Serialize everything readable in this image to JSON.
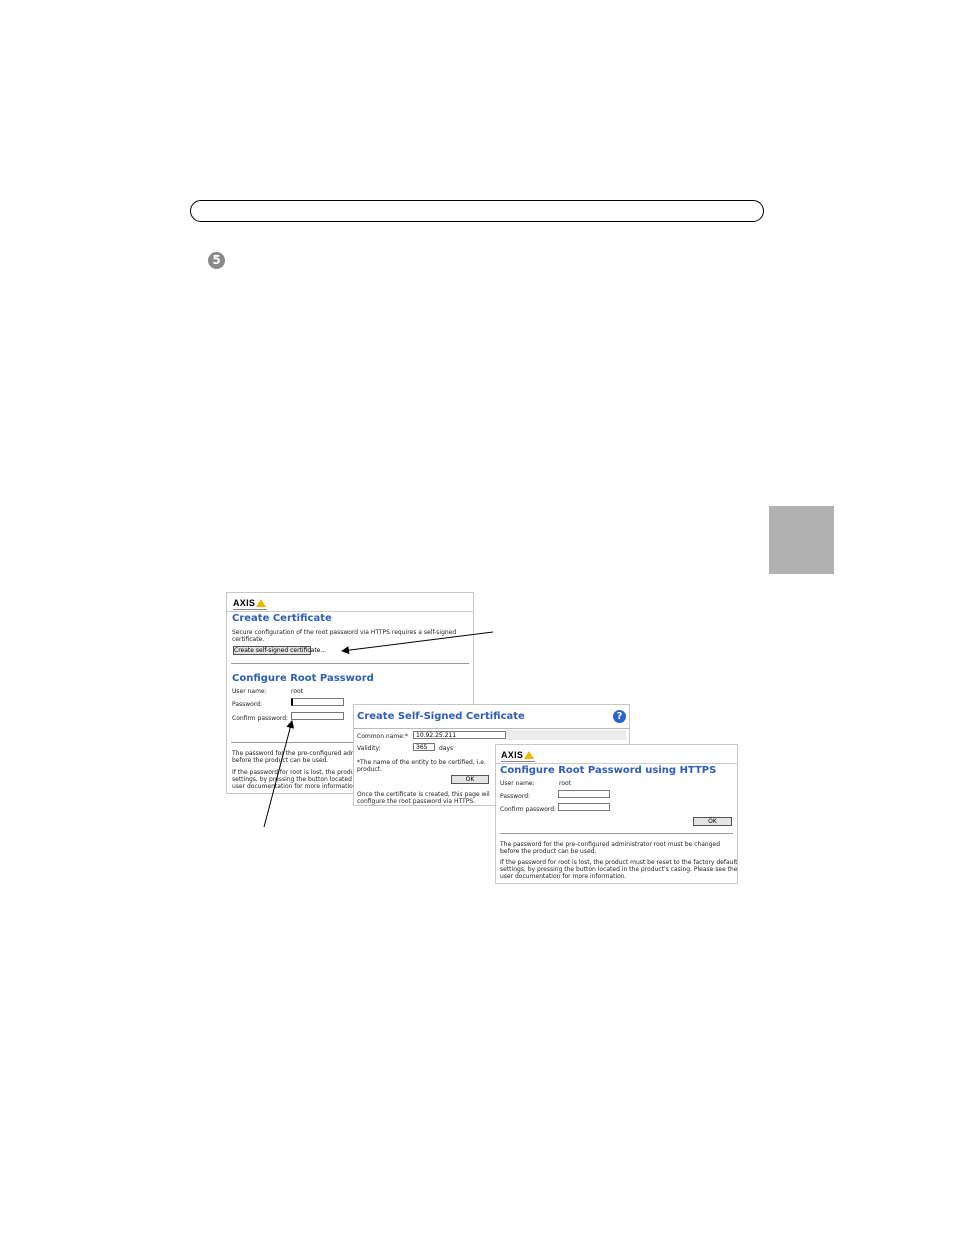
{
  "page": {
    "step_number": "5"
  },
  "panel_create_cert": {
    "logo": "AXIS",
    "title": "Create Certificate",
    "desc_line1": "Secure configuration of the root password via HTTPS requires a self-signed",
    "desc_line2": "certificate.",
    "button_label": "Create self-signed certificate...",
    "section_title": "Configure Root Password",
    "user_name_label": "User name:",
    "user_name_value": "root",
    "password_label": "Password:",
    "confirm_label": "Confirm password:",
    "note1_line1": "The password for the pre-configured admin",
    "note1_line2": "before the product can be used.",
    "note2_line1": "If the password for root is lost, the produ",
    "note2_line2": "settings, by pressing the button located i",
    "note2_line3": "user documentation for more information."
  },
  "panel_self_signed": {
    "title": "Create Self-Signed Certificate",
    "common_name_label": "Common name:*",
    "common_name_value": "10.92.25.211",
    "validity_label": "Validity:",
    "validity_value": "365",
    "validity_unit": "days",
    "note_line1": "*The name of the entity to be certified, i.e.",
    "note_line2": "product.",
    "ok_label": "OK",
    "after_line1": "Once the certificate is created, this page wil",
    "after_line2": "configure the root password via HTTPS.",
    "help_icon": "?"
  },
  "panel_https": {
    "logo": "AXIS",
    "title": "Configure Root Password using HTTPS",
    "user_name_label": "User name:",
    "user_name_value": "root",
    "password_label": "Password:",
    "confirm_label": "Confirm password:",
    "ok_label": "OK",
    "note1_line1": "The password for the pre-configured administrator root must be changed",
    "note1_line2": "before the product can be used.",
    "note2_line1": "If the password for root is lost, the product must be reset to the factory default",
    "note2_line2": "settings, by pressing the button located in the product's casing. Please see the",
    "note2_line3": "user documentation for more information."
  },
  "colors": {
    "title_blue": "#2e5fb5",
    "side_tab_gray": "#b1b1b1",
    "axis_yellow": "#f5b400"
  }
}
